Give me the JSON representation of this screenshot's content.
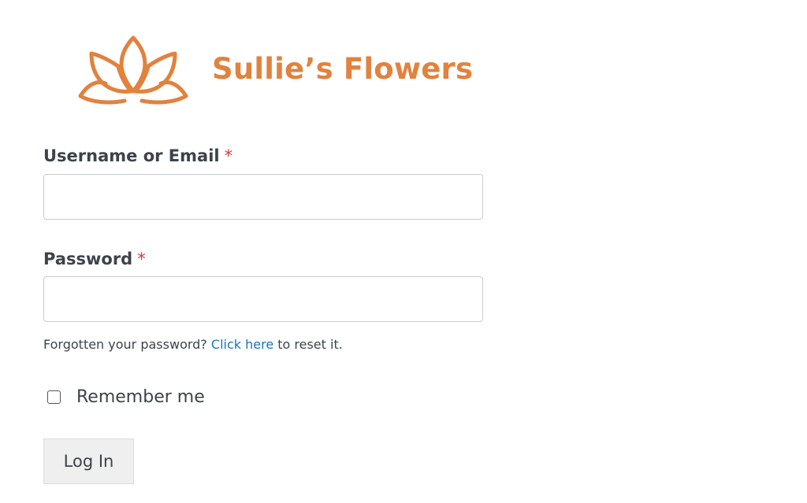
{
  "brand": {
    "name": "Sullie’s Flowers",
    "icon": "lotus-logo-icon",
    "color": "#e1823e"
  },
  "form": {
    "username": {
      "label": "Username or Email",
      "required_marker": "*",
      "value": ""
    },
    "password": {
      "label": "Password",
      "required_marker": "*",
      "value": ""
    },
    "forgot": {
      "prefix": "Forgotten your password?",
      "link_text": "Click here",
      "suffix": "to reset it."
    },
    "remember": {
      "label": "Remember me",
      "checked": false
    },
    "submit_label": "Log In"
  },
  "colors": {
    "text": "#3c434a",
    "required": "#d63638",
    "link": "#1a73b8",
    "button_bg": "#efefef"
  }
}
